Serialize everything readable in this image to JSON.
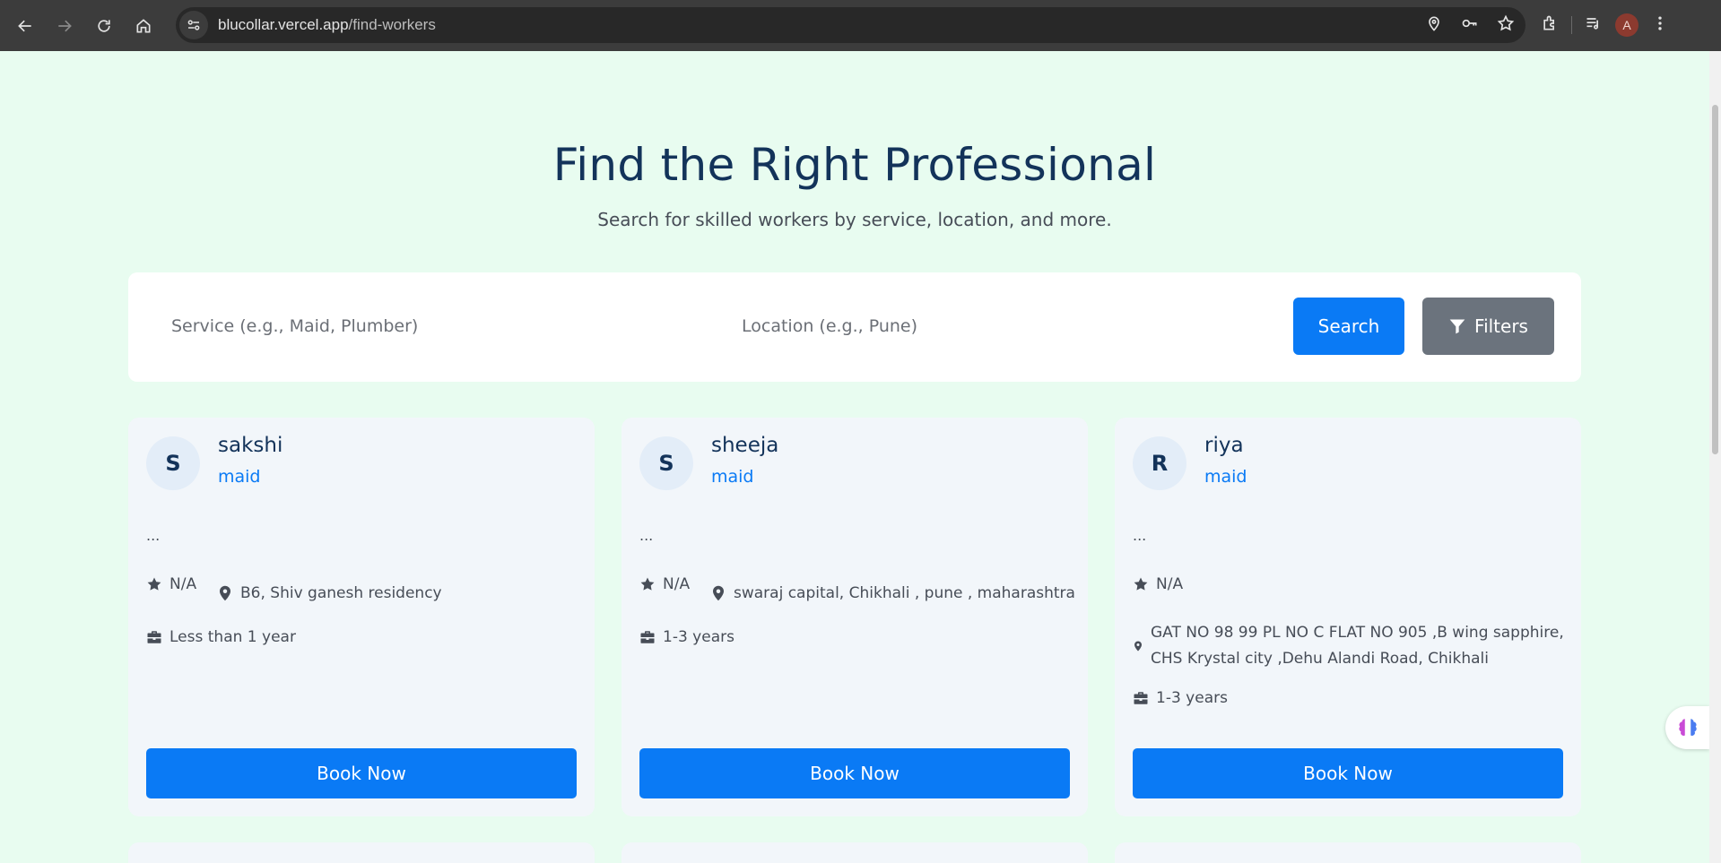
{
  "browser": {
    "url_host": "blucollar.vercel.app",
    "url_path": "/find-workers",
    "profile_initial": "A"
  },
  "hero": {
    "title": "Find the Right Professional",
    "subtitle": "Search for skilled workers by service, location, and more."
  },
  "search": {
    "service_placeholder": "Service (e.g., Maid, Plumber)",
    "location_placeholder": "Location (e.g., Pune)",
    "search_label": "Search",
    "filters_label": "Filters"
  },
  "workers": [
    {
      "initial": "S",
      "name": "sakshi",
      "service": "maid",
      "description": "...",
      "rating": "N/A",
      "location": "B6, Shiv ganesh residency",
      "experience": "Less than 1 year",
      "book_label": "Book Now"
    },
    {
      "initial": "S",
      "name": "sheeja",
      "service": "maid",
      "description": "...",
      "rating": "N/A",
      "location": "swaraj capital, Chikhali , pune , maharashtra",
      "experience": "1-3 years",
      "book_label": "Book Now"
    },
    {
      "initial": "R",
      "name": "riya",
      "service": "maid",
      "description": "...",
      "rating": "N/A",
      "location_line1": "GAT NO 98 99 PL NO C FLAT NO 905 ,B wing sapphire,",
      "location_line2": "CHS Krystal city ,Dehu Alandi Road, Chikhali",
      "experience": "1-3 years",
      "book_label": "Book Now"
    }
  ],
  "colors": {
    "page_bg": "#e8fcf0",
    "primary": "#0a7af5",
    "heading": "#13335a",
    "filters_bg": "#6b737d",
    "card_bg": "#f2f6fa"
  },
  "icons": [
    "back-arrow-icon",
    "forward-arrow-icon",
    "reload-icon",
    "home-icon",
    "site-settings-icon",
    "location-pin-icon",
    "password-key-icon",
    "bookmark-star-icon",
    "extensions-icon",
    "media-control-icon",
    "more-menu-icon",
    "filter-funnel-icon",
    "star-icon",
    "map-marker-icon",
    "briefcase-icon",
    "brain-widget-icon"
  ]
}
